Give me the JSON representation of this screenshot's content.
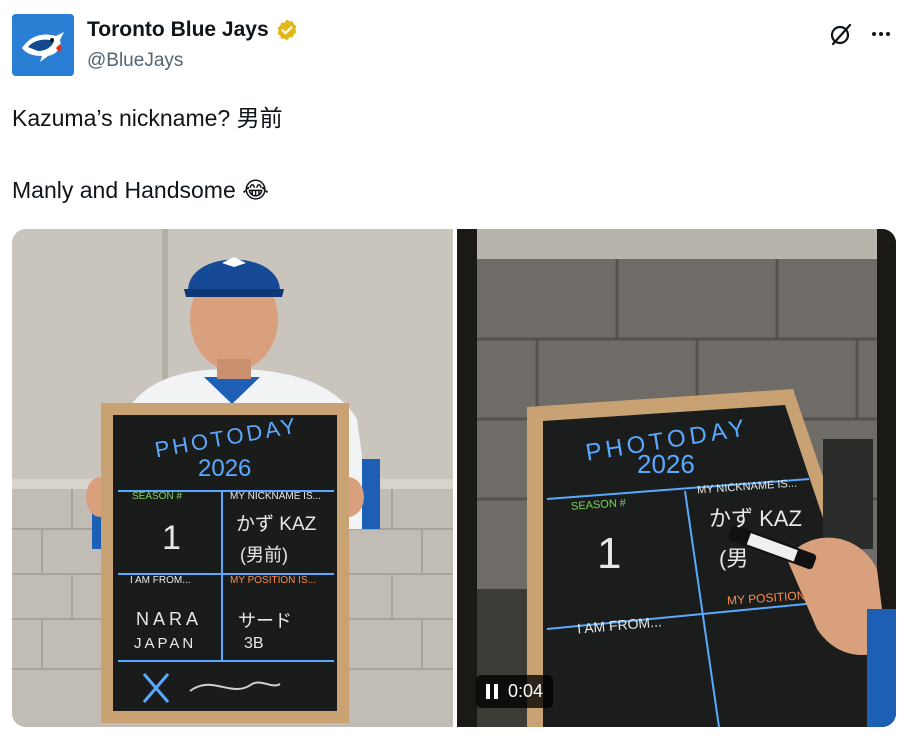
{
  "account": {
    "display_name": "Toronto Blue Jays",
    "handle": "@BlueJays",
    "verified_badge": "verified-badge-icon"
  },
  "tweet": {
    "text": "Kazuma’s nickname? 男前\n\nManly and Handsome 😂"
  },
  "media": {
    "photo": {
      "board": {
        "title_line1": "PHOTODAY",
        "title_line2": "2026",
        "season_label": "SEASON #",
        "season_value": "1",
        "nickname_label": "MY NICKNAME IS...",
        "nickname_value": "かず KAZ",
        "nickname_value2": "(男前)",
        "from_label": "I AM FROM...",
        "from_value1": "NARA",
        "from_value2": "JAPAN",
        "position_label": "MY POSITION IS...",
        "position_value1": "サード",
        "position_value2": "3B"
      }
    },
    "video": {
      "time": "0:04",
      "board": {
        "title_line1": "PHOTODAY",
        "title_line2": "2026",
        "season_label": "SEASON #",
        "season_value": "1",
        "nickname_label": "MY NICKNAME IS...",
        "nickname_value": "かず KAZ",
        "nickname_value2": "(男",
        "from_label": "I AM FROM...",
        "position_label": "MY POSITION"
      }
    }
  },
  "colors": {
    "brand_blue": "#134a8e",
    "verified_gold": "#e2b719",
    "chalk_blue": "#5aa9ff",
    "chalk_green": "#7bd35a",
    "chalk_orange": "#ff8a4a"
  }
}
